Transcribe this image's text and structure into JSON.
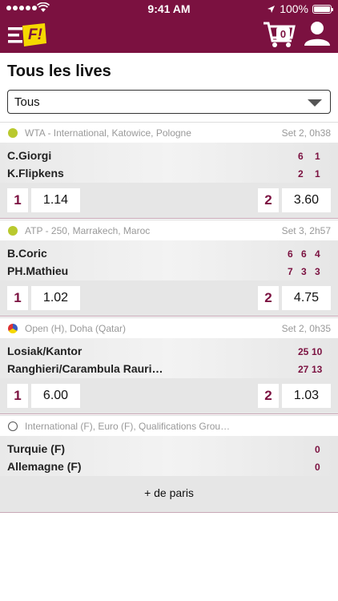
{
  "status_bar": {
    "time": "9:41 AM",
    "battery": "100%"
  },
  "header": {
    "cart_count": "0",
    "logo_text": "F!"
  },
  "page": {
    "title": "Tous les lives",
    "filter_value": "Tous"
  },
  "events": [
    {
      "sport_icon": "tennis-ball-icon",
      "competition": "WTA - International, Katowice, Pologne",
      "status": "Set 2, 0h38",
      "teams": [
        {
          "name": "C.Giorgi",
          "scores": [
            "6",
            "1"
          ]
        },
        {
          "name": "K.Flipkens",
          "scores": [
            "2",
            "1"
          ]
        }
      ],
      "odds": [
        {
          "label": "1",
          "value": "1.14"
        },
        {
          "label": "2",
          "value": "3.60"
        }
      ]
    },
    {
      "sport_icon": "tennis-ball-icon",
      "competition": "ATP - 250, Marrakech, Maroc",
      "status": "Set 3, 2h57",
      "teams": [
        {
          "name": "B.Coric",
          "scores": [
            "6",
            "6",
            "4"
          ]
        },
        {
          "name": "PH.Mathieu",
          "scores": [
            "7",
            "3",
            "3"
          ]
        }
      ],
      "odds": [
        {
          "label": "1",
          "value": "1.02"
        },
        {
          "label": "2",
          "value": "4.75"
        }
      ]
    },
    {
      "sport_icon": "volleyball-icon",
      "competition": "Open (H), Doha (Qatar)",
      "status": "Set 2, 0h35",
      "teams": [
        {
          "name": "Losiak/Kantor",
          "scores": [
            "25",
            "10"
          ]
        },
        {
          "name": "Ranghieri/Carambula Rauri…",
          "scores": [
            "27",
            "13"
          ]
        }
      ],
      "odds": [
        {
          "label": "1",
          "value": "6.00"
        },
        {
          "label": "2",
          "value": "1.03"
        }
      ]
    },
    {
      "sport_icon": "football-icon",
      "competition": "International (F), Euro (F), Qualifications Grou…",
      "status": "",
      "teams": [
        {
          "name": "Turquie (F)",
          "scores": [
            "0"
          ]
        },
        {
          "name": "Allemagne (F)",
          "scores": [
            "0"
          ]
        }
      ],
      "more_label": "+ de paris"
    }
  ],
  "colors": {
    "brand": "#7b1140",
    "logo_yellow": "#f5d800",
    "tennis_ball": "#b9c92e"
  }
}
